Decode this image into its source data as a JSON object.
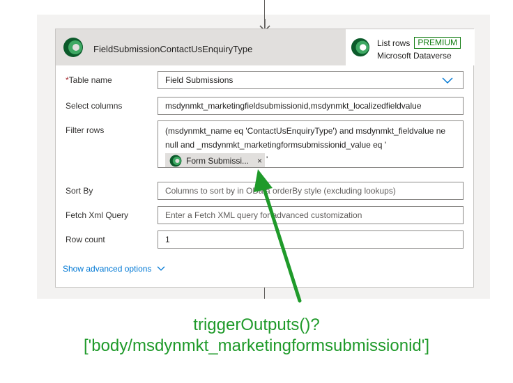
{
  "card": {
    "title": "FieldSubmissionContactUsEnquiryType",
    "action_name": "List rows",
    "premium_badge": "PREMIUM",
    "connector": "Microsoft Dataverse"
  },
  "fields": {
    "table_name": {
      "label": "Table name",
      "required_mark": "*",
      "value": "Field Submissions"
    },
    "select_columns": {
      "label": "Select columns",
      "value": "msdynmkt_marketingfieldsubmissionid,msdynmkt_localizedfieldvalue"
    },
    "filter_rows": {
      "label": "Filter rows",
      "text": "(msdynmkt_name eq 'ContactUsEnquiryType') and msdynmkt_fieldvalue ne null and _msdynmkt_marketingformsubmissionid_value eq '",
      "token_label": "Form Submissi...",
      "token_close": "×",
      "trailing": "'"
    },
    "sort_by": {
      "label": "Sort By",
      "placeholder": "Columns to sort by in OData orderBy style (excluding lookups)"
    },
    "fetch_xml": {
      "label": "Fetch Xml Query",
      "placeholder": "Enter a Fetch XML query for advanced customization"
    },
    "row_count": {
      "label": "Row count",
      "value": "1"
    }
  },
  "advanced_options": "Show advanced options",
  "annotation": {
    "line1": "triggerOutputs()?",
    "line2": "['body/msdynmkt_marketingformsubmissionid']"
  },
  "colors": {
    "annotation": "#1f9a2a",
    "link": "#0078d4",
    "premium": "#107c10"
  },
  "icons": [
    "arrow-down-icon",
    "dataverse-logo-icon",
    "chevron-down-icon",
    "close-icon"
  ]
}
